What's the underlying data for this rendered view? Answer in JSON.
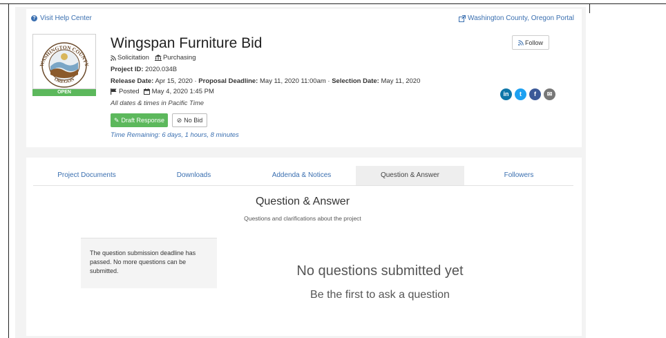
{
  "header": {
    "help_link": "Visit Help Center",
    "portal_link": "Washington County, Oregon Portal"
  },
  "logo": {
    "org_top": "WASHINGTON COUNTY",
    "org_bottom": "OREGON",
    "status": "OPEN"
  },
  "project": {
    "title": "Wingspan Furniture Bid",
    "type": "Solicitation",
    "department": "Purchasing",
    "project_id_label": "Project ID:",
    "project_id": "2020.034B",
    "release_label": "Release Date:",
    "release_date": "Apr 15, 2020",
    "proposal_label": "Proposal Deadline:",
    "proposal_deadline": "May 11, 2020 11:00am",
    "selection_label": "Selection Date:",
    "selection_date": "May 11, 2020",
    "posted_label": "Posted",
    "posted_date": "May 4, 2020 1:45 PM",
    "timezone_note": "All dates & times in Pacific Time",
    "time_remaining": "Time Remaining: 6 days, 1 hours, 8 minutes"
  },
  "actions": {
    "draft_response": "Draft Response",
    "no_bid": "No Bid",
    "follow": "Follow"
  },
  "social": {
    "linkedin": "in",
    "twitter": "t",
    "facebook": "f",
    "email": "✉",
    "colors": {
      "linkedin": "#0e76a8",
      "twitter": "#1da1f2",
      "facebook": "#3b5998",
      "email": "#777777"
    }
  },
  "tabs": [
    {
      "label": "Project Documents"
    },
    {
      "label": "Downloads"
    },
    {
      "label": "Addenda & Notices"
    },
    {
      "label": "Question & Answer"
    },
    {
      "label": "Followers"
    }
  ],
  "qa": {
    "title": "Question & Answer",
    "subtitle": "Questions and clarifications about the project",
    "notice": "The question submission deadline has passed. No more questions can be submitted.",
    "empty_title": "No questions submitted yet",
    "empty_subtitle": "Be the first to ask a question"
  },
  "colors": {
    "accent": "#3a6fb0",
    "success": "#5cb85c"
  }
}
